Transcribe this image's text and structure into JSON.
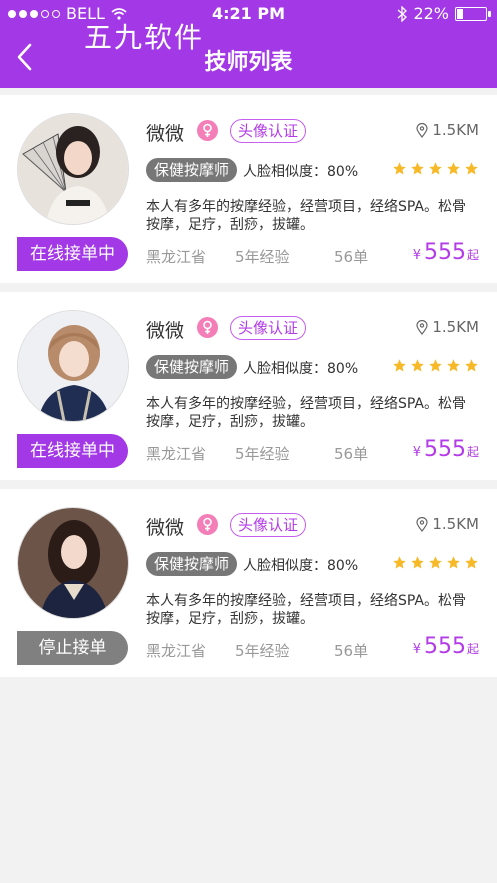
{
  "status_bar": {
    "carrier": "BELL",
    "time": "4:21 PM",
    "battery": "22%"
  },
  "watermark": "五九软件",
  "header": {
    "title": "技师列表"
  },
  "colors": {
    "brand": "#a338e6",
    "star": "#f7b928",
    "female": "#f47eb7"
  },
  "technicians": [
    {
      "name": "微微",
      "verify": "头像认证",
      "distance": "1.5KM",
      "job": "保健按摩师",
      "similarity": "人脸相似度：80%",
      "rating": 5,
      "description": "本人有多年的按摩经验，经营项目，经络SPA。松骨按摩，足疗，刮痧，拔罐。",
      "status": "在线接单中",
      "province": "黑龙江省",
      "experience": "5年经验",
      "orders": "56单",
      "currency": "¥",
      "price": "555",
      "price_unit": "起"
    },
    {
      "name": "微微",
      "verify": "头像认证",
      "distance": "1.5KM",
      "job": "保健按摩师",
      "similarity": "人脸相似度：80%",
      "rating": 5,
      "description": "本人有多年的按摩经验，经营项目，经络SPA。松骨按摩，足疗，刮痧，拔罐。",
      "status": "在线接单中",
      "province": "黑龙江省",
      "experience": "5年经验",
      "orders": "56单",
      "currency": "¥",
      "price": "555",
      "price_unit": "起"
    },
    {
      "name": "微微",
      "verify": "头像认证",
      "distance": "1.5KM",
      "job": "保健按摩师",
      "similarity": "人脸相似度：80%",
      "rating": 5,
      "description": "本人有多年的按摩经验，经营项目，经络SPA。松骨按摩，足疗，刮痧，拔罐。",
      "status": "停止接单",
      "province": "黑龙江省",
      "experience": "5年经验",
      "orders": "56单",
      "currency": "¥",
      "price": "555",
      "price_unit": "起"
    }
  ]
}
